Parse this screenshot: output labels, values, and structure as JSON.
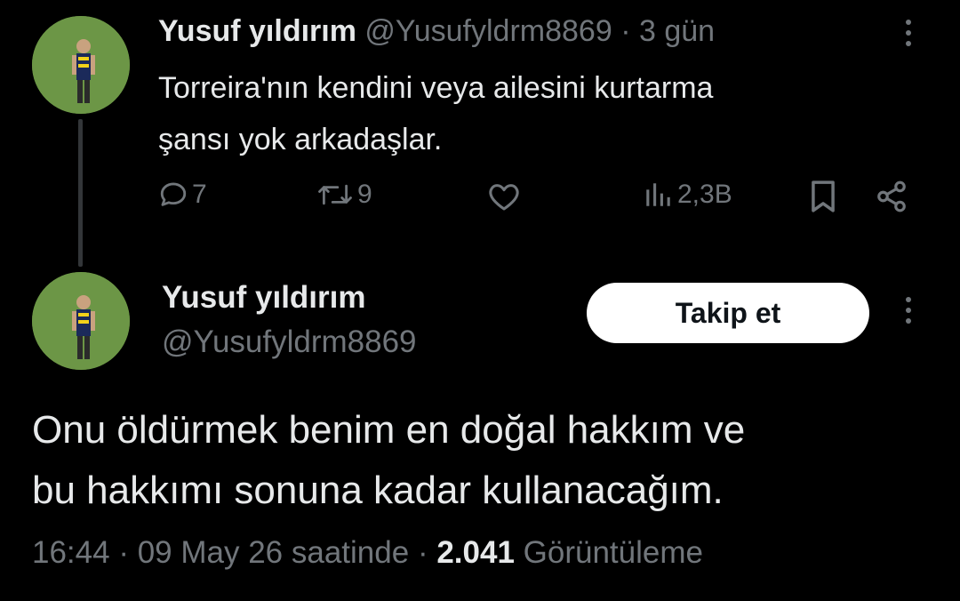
{
  "reply_tweet": {
    "display_name": "Yusuf yıldırım",
    "handle": "@Yusufyldrm8869",
    "separator": "·",
    "time_ago": "3 gün",
    "text_line1": "Torreira'nın kendini veya ailesini kurtarma",
    "text_line2": "şansı yok arkadaşlar.",
    "actions": {
      "reply_count": "7",
      "retweet_count": "9",
      "views": "2,3B"
    }
  },
  "main_tweet": {
    "display_name": "Yusuf yıldırım",
    "handle": "@Yusufyldrm8869",
    "follow_label": "Takip et",
    "text_line1": "Onu öldürmek benim en doğal hakkım ve",
    "text_line2": "bu hakkımı sonuna kadar kullanacağım.",
    "time": "16:44",
    "separator": "·",
    "date": "09 May 26 saatinde",
    "view_count": "2.041",
    "view_label": "Görüntüleme"
  },
  "colors": {
    "background": "#000000",
    "text": "#e7e9ea",
    "muted": "#71767b",
    "follow_bg": "#ffffff"
  },
  "icons": [
    "reply-icon",
    "retweet-icon",
    "like-icon",
    "views-icon",
    "bookmark-icon",
    "share-icon",
    "more-icon"
  ]
}
